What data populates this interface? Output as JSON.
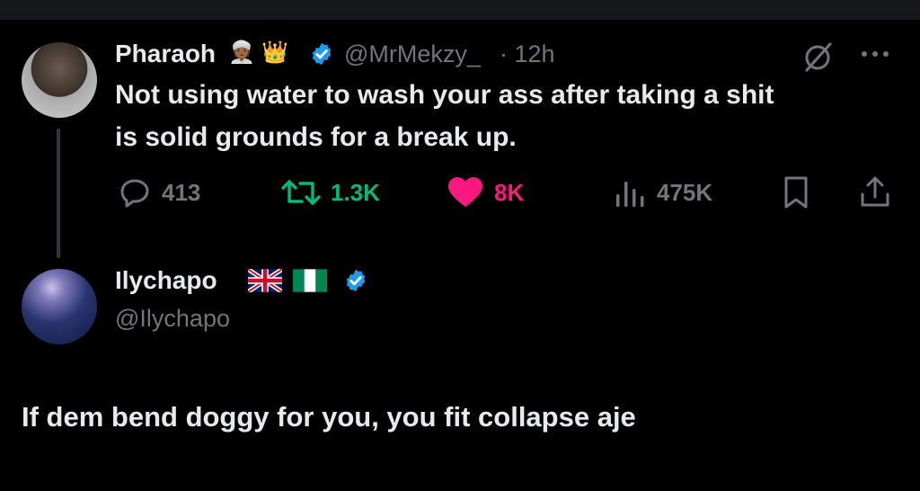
{
  "original_tweet": {
    "display_name": "Pharaoh",
    "name_emojis": [
      "man-with-turban-emoji",
      "crown-emoji"
    ],
    "handle": "@MrMekzy_",
    "time": "· 12h",
    "text_line1": "Not using water to wash your ass after taking a shit",
    "text_line2": "is solid grounds for a break up.",
    "replies": "413",
    "reposts": "1.3K",
    "likes": "8K",
    "views": "475K",
    "colors": {
      "repost": "#00ba7c",
      "like": "#f91880",
      "verified": "#1d9bf0"
    }
  },
  "reply_tweet": {
    "display_name": "Ilychapo",
    "name_emojis": [
      "uk-flag-emoji",
      "nigeria-flag-emoji"
    ],
    "handle": "@Ilychapo",
    "text": "If dem bend doggy for you, you fit collapse aje"
  }
}
